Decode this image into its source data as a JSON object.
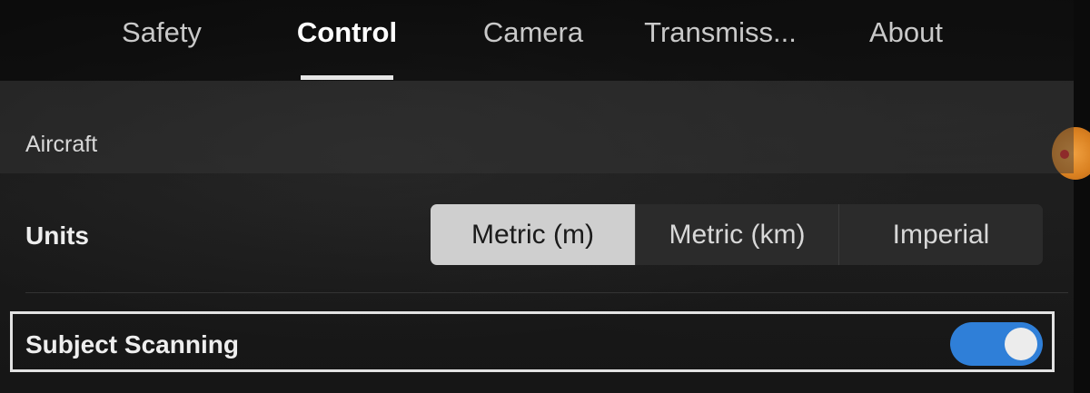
{
  "tabs": [
    {
      "label": "Safety",
      "active": false
    },
    {
      "label": "Control",
      "active": true
    },
    {
      "label": "Camera",
      "active": false
    },
    {
      "label": "Transmiss...",
      "active": false
    },
    {
      "label": "About",
      "active": false
    }
  ],
  "section": {
    "title": "Aircraft"
  },
  "units": {
    "label": "Units",
    "options": [
      "Metric (m)",
      "Metric (km)",
      "Imperial"
    ],
    "selected": "Metric (m)"
  },
  "subject_scanning": {
    "label": "Subject Scanning",
    "enabled": true
  },
  "colors": {
    "toggle_on": "#2f7fd8",
    "selected_segment": "#cfcfcf"
  }
}
